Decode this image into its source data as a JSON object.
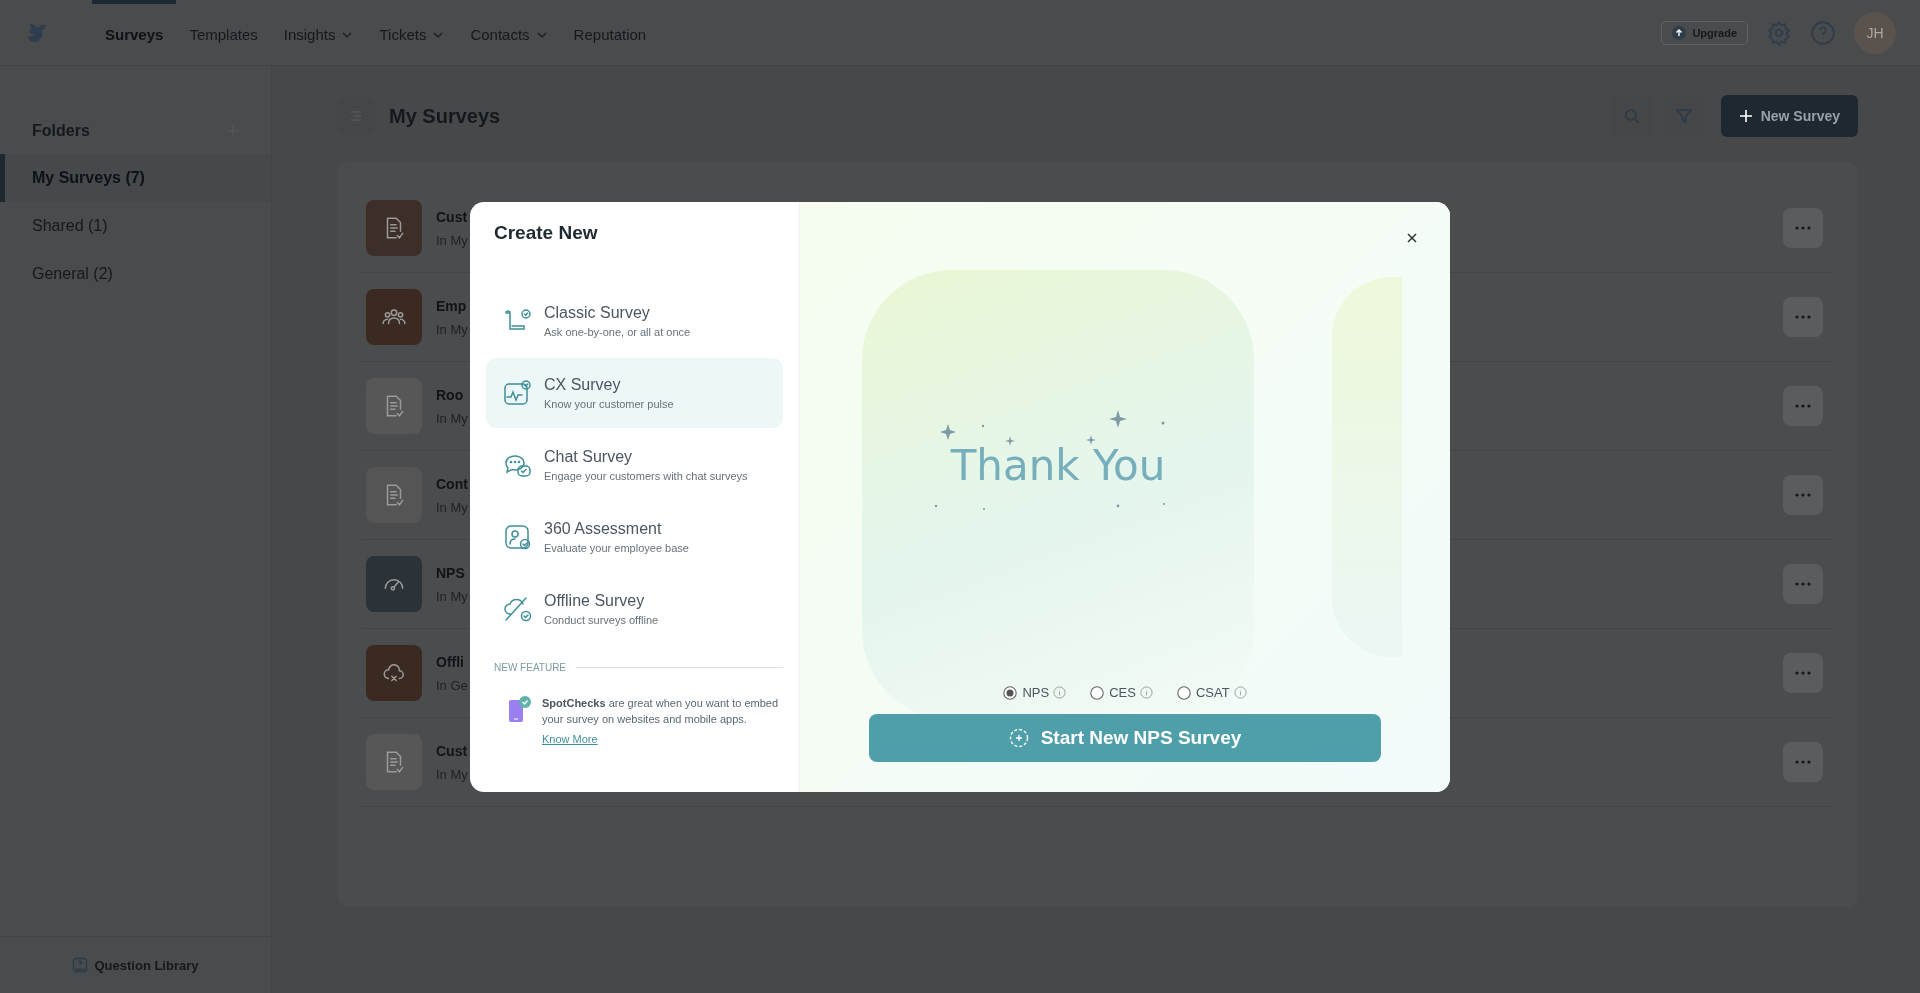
{
  "top_nav": {
    "items": [
      {
        "label": "Surveys",
        "selected": true,
        "dropdown": false
      },
      {
        "label": "Templates",
        "selected": false,
        "dropdown": false
      },
      {
        "label": "Insights",
        "selected": false,
        "dropdown": true
      },
      {
        "label": "Tickets",
        "selected": false,
        "dropdown": true
      },
      {
        "label": "Contacts",
        "selected": false,
        "dropdown": true
      },
      {
        "label": "Reputation",
        "selected": false,
        "dropdown": false
      }
    ],
    "upgrade": "Upgrade",
    "avatar": "JH"
  },
  "sidebar": {
    "title": "Folders",
    "items": [
      {
        "label": "My Surveys (7)",
        "selected": true
      },
      {
        "label": "Shared (1)",
        "selected": false
      },
      {
        "label": "General (2)",
        "selected": false
      }
    ],
    "footer": "Question Library"
  },
  "main": {
    "title": "My Surveys",
    "new_button": "New Survey",
    "rows": [
      {
        "title": "Cust",
        "subtitle": "In My",
        "kind": "document",
        "color": "#3d2e27"
      },
      {
        "title": "Emp",
        "subtitle": "In My",
        "kind": "people",
        "color": "#3a2a22"
      },
      {
        "title": "Roo",
        "subtitle": "In My",
        "kind": "document",
        "color": "#575757"
      },
      {
        "title": "Cont",
        "subtitle": "In My",
        "kind": "document",
        "color": "#555555"
      },
      {
        "title": "NPS",
        "subtitle": "In My",
        "kind": "gauge",
        "color": "#2c3338"
      },
      {
        "title": "Offli",
        "subtitle": "In Ge",
        "kind": "cloud",
        "color": "#3a2a22"
      },
      {
        "title": "Cust",
        "subtitle": "In My",
        "kind": "document",
        "color": "#575757"
      }
    ]
  },
  "modal": {
    "title": "Create New",
    "options": [
      {
        "kind": "classic",
        "title": "Classic Survey",
        "description": "Ask one-by-one, or all at once",
        "selected": false
      },
      {
        "kind": "cx",
        "title": "CX Survey",
        "description": "Know your customer pulse",
        "selected": true
      },
      {
        "kind": "chat",
        "title": "Chat Survey",
        "description": "Engage your customers with chat surveys",
        "selected": false
      },
      {
        "kind": "assessment",
        "title": "360 Assessment",
        "description": "Evaluate your employee base",
        "selected": false
      },
      {
        "kind": "offline",
        "title": "Offline Survey",
        "description": "Conduct surveys offline",
        "selected": false
      }
    ],
    "new_feature": {
      "heading": "NEW FEATURE",
      "text": "**SpotChecks** are great when you want to embed your survey on websites and mobile apps.",
      "link": "Know More"
    },
    "preview_text": "Thank You",
    "survey_types": [
      {
        "label": "NPS",
        "selected": true
      },
      {
        "label": "CES",
        "selected": false
      },
      {
        "label": "CSAT",
        "selected": false
      }
    ],
    "start_button": "Start New NPS Survey"
  }
}
